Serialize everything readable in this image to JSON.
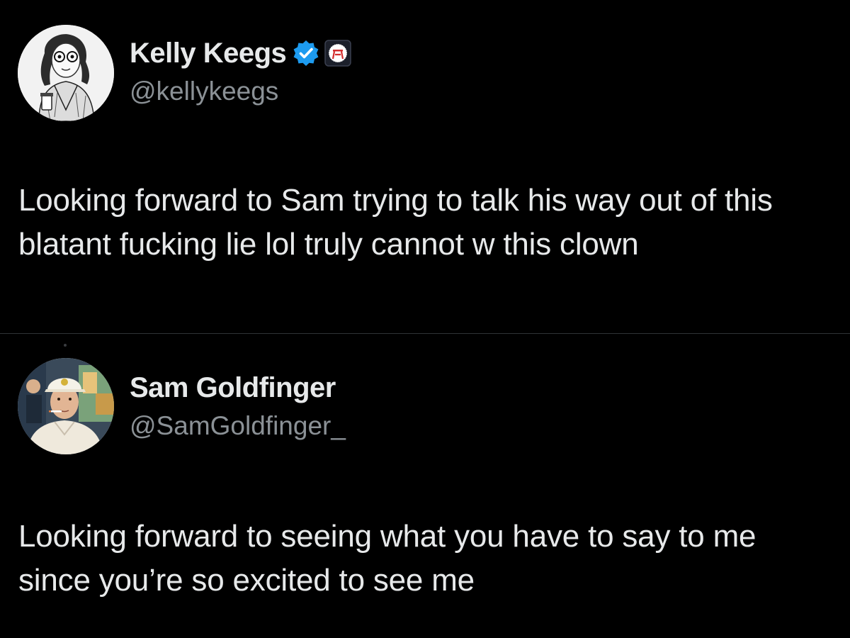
{
  "colors": {
    "background": "#000000",
    "text_primary": "#e7e9ea",
    "text_secondary": "#8b9196",
    "divider": "#2f3336",
    "verified_blue": "#1d9bf0",
    "affiliate_badge_bg": "#1b1f2a",
    "affiliate_badge_red": "#d32f2f"
  },
  "tweets": [
    {
      "author": {
        "display_name": "Kelly Keegs",
        "handle": "@kellykeegs",
        "avatar_icon": "sketch-portrait-avatar",
        "verified_icon": "verified-badge-icon",
        "affiliate_icon": "barstool-affiliate-badge-icon"
      },
      "text": "Looking forward to Sam trying to talk his way out of this blatant fucking lie lol truly cannot w this clown"
    },
    {
      "author": {
        "display_name": "Sam Goldfinger",
        "handle": "@SamGoldfinger_",
        "avatar_icon": "photo-portrait-avatar"
      },
      "text": "Looking forward to seeing what you have to say to me since you’re so excited to see me"
    }
  ]
}
